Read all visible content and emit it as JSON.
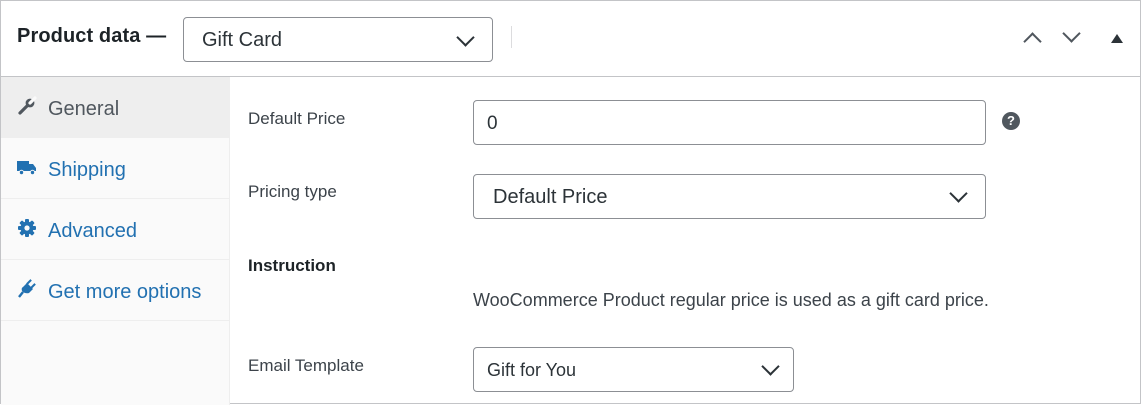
{
  "header": {
    "title": "Product data —",
    "product_type": "Gift Card"
  },
  "sidebar": {
    "items": [
      {
        "label": "General",
        "icon": "wrench-icon",
        "active": true
      },
      {
        "label": "Shipping",
        "icon": "truck-icon",
        "active": false
      },
      {
        "label": "Advanced",
        "icon": "gear-icon",
        "active": false
      },
      {
        "label": "Get more options",
        "icon": "plug-icon",
        "active": false
      }
    ]
  },
  "form": {
    "default_price": {
      "label": "Default Price",
      "value": "0",
      "help": "?"
    },
    "pricing_type": {
      "label": "Pricing type",
      "value": "Default Price"
    },
    "instruction": {
      "label": "Instruction",
      "text": "WooCommerce Product regular price is used as a gift card price."
    },
    "email_template": {
      "label": "Email Template",
      "value": "Gift for You"
    }
  },
  "colors": {
    "link": "#2271b1",
    "active_text": "#50575e",
    "border": "#c3c4c7"
  }
}
